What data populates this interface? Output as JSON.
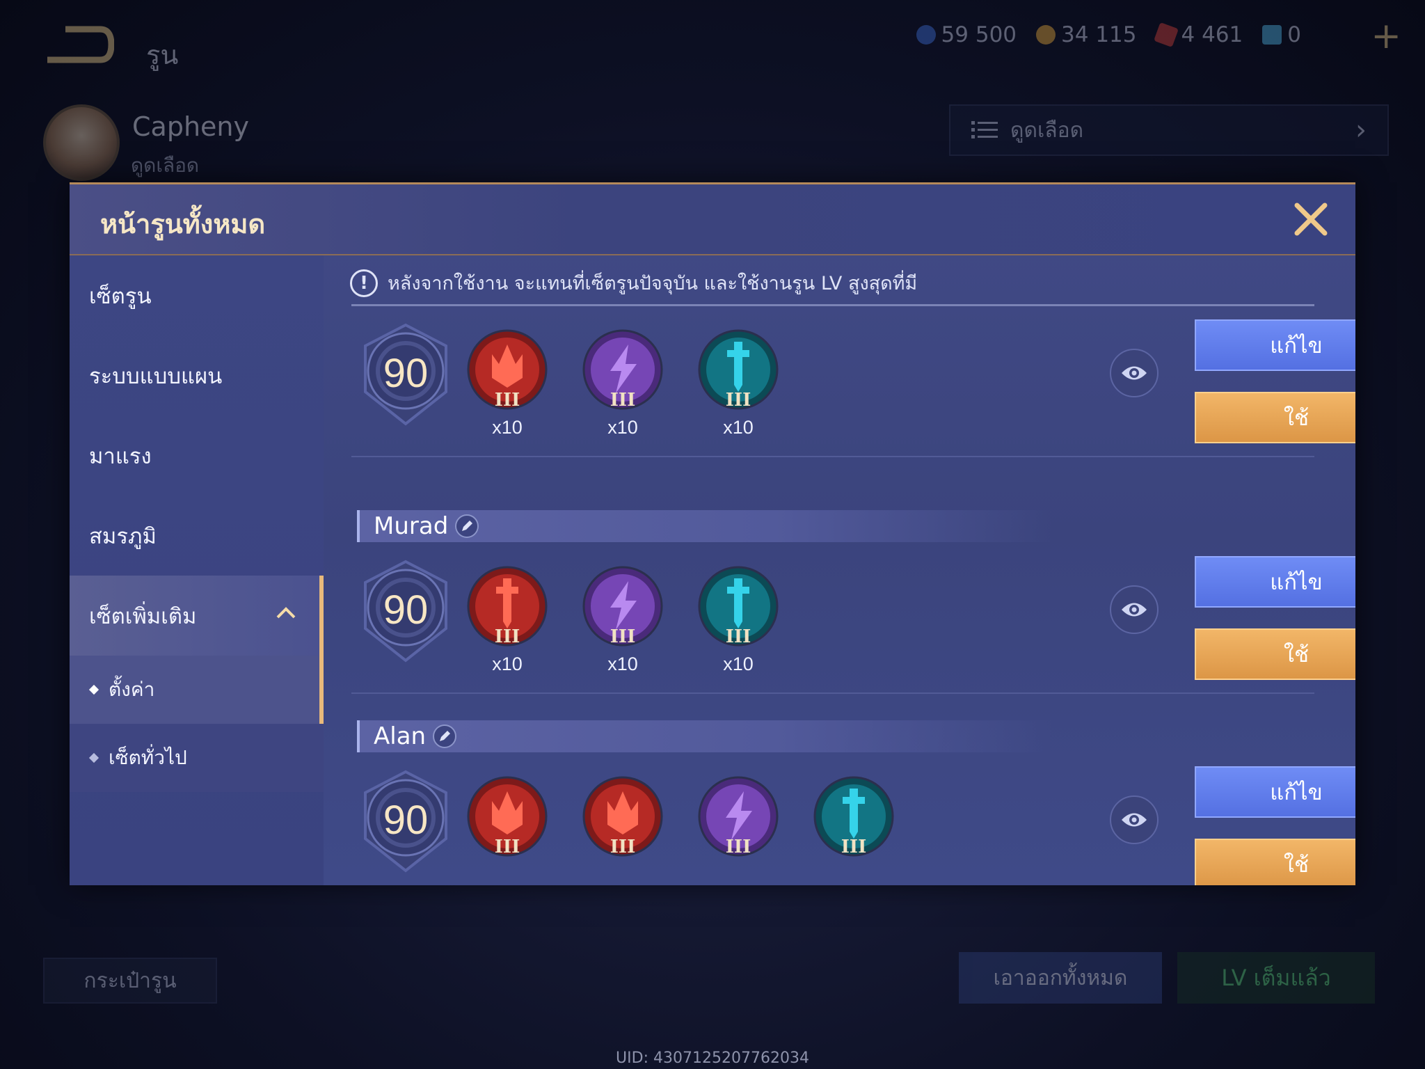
{
  "background": {
    "page_title": "รูน",
    "currencies": [
      {
        "icon": "diamond-icon",
        "value": "59 500",
        "color": "#3f6fd6"
      },
      {
        "icon": "gold-coin-icon",
        "value": "34 115",
        "color": "#e4a83a"
      },
      {
        "icon": "rune-fragment-icon",
        "value": "4 461",
        "color": "#d0403a"
      },
      {
        "icon": "voucher-icon",
        "value": "0",
        "color": "#4fb3e0"
      }
    ],
    "hero_name": "Capheny",
    "hero_subtitle": "ดูดเลือด",
    "filter_label": "ดูดเลือด",
    "bag_button": "กระเป๋ารูน",
    "remove_all_button": "เอาออกทั้งหมด",
    "lv_full_button": "LV เต็มแล้ว",
    "uid": "UID: 4307125207762034"
  },
  "modal": {
    "title": "หน้ารูนทั้งหมด",
    "notice": "หลังจากใช้งาน จะแทนที่เซ็ตรูนปัจจุบัน และใช้งานรูน LV สูงสุดที่มี",
    "sidebar": {
      "items": [
        {
          "label": "เซ็ตรูน"
        },
        {
          "label": "ระบบแบบแผน"
        },
        {
          "label": "มาแรง"
        },
        {
          "label": "สมรภูมิ"
        },
        {
          "label": "เซ็ตเพิ่มเติม"
        }
      ],
      "subitems": [
        {
          "label": "ตั้งค่า"
        },
        {
          "label": "เซ็ตทั่วไป"
        }
      ]
    },
    "edit_label": "แก้ไข",
    "use_label": "ใช้",
    "sets": [
      {
        "name": "",
        "level": "90",
        "runes": [
          {
            "color": "red",
            "tier": "III",
            "count": "x10",
            "symbol": "flame"
          },
          {
            "color": "purple",
            "tier": "III",
            "count": "x10",
            "symbol": "lightning"
          },
          {
            "color": "teal",
            "tier": "III",
            "count": "x10",
            "symbol": "sword"
          }
        ]
      },
      {
        "name": "Murad",
        "level": "90",
        "runes": [
          {
            "color": "red",
            "tier": "III",
            "count": "x10",
            "symbol": "sword"
          },
          {
            "color": "purple",
            "tier": "III",
            "count": "x10",
            "symbol": "lightning"
          },
          {
            "color": "teal",
            "tier": "III",
            "count": "x10",
            "symbol": "sword"
          }
        ]
      },
      {
        "name": "Alan",
        "level": "90",
        "runes": [
          {
            "color": "red",
            "tier": "III",
            "count": "",
            "symbol": "flame"
          },
          {
            "color": "red",
            "tier": "III",
            "count": "",
            "symbol": "flame"
          },
          {
            "color": "purple",
            "tier": "III",
            "count": "",
            "symbol": "lightning"
          },
          {
            "color": "teal",
            "tier": "III",
            "count": "",
            "symbol": "sword"
          }
        ]
      }
    ]
  }
}
